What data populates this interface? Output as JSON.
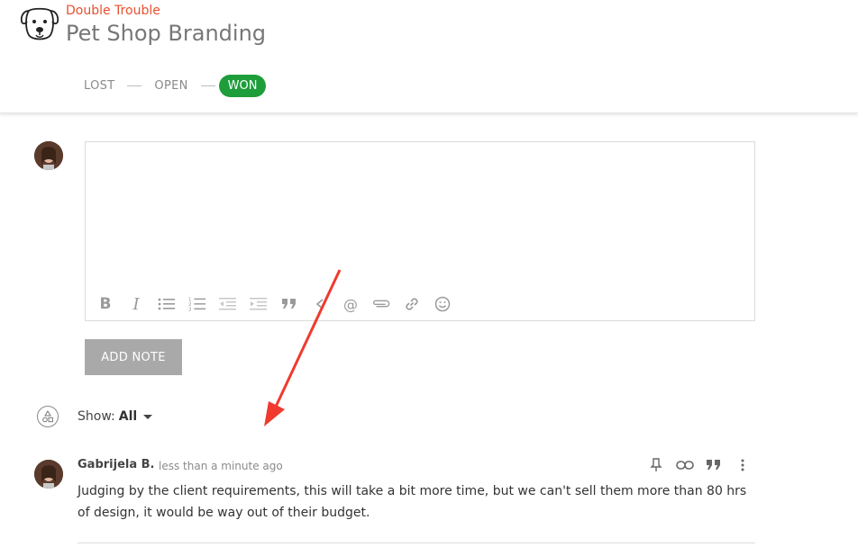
{
  "header": {
    "client_name": "Double Trouble",
    "project_title": "Pet Shop Branding",
    "logo_icon": "dog-face-icon",
    "stages": [
      {
        "label": "LOST",
        "active": false
      },
      {
        "label": "OPEN",
        "active": false
      },
      {
        "label": "WON",
        "active": true
      }
    ]
  },
  "editor": {
    "toolbar": [
      "bold-icon",
      "italic-icon",
      "bullet-list-icon",
      "numbered-list-icon",
      "outdent-icon",
      "indent-icon",
      "quote-icon",
      "code-icon",
      "mention-icon",
      "attachment-icon",
      "link-icon",
      "emoji-icon"
    ],
    "bold_glyph": "B",
    "italic_glyph": "I",
    "mention_glyph": "@",
    "add_note_label": "ADD NOTE"
  },
  "filter": {
    "show_label": "Show:",
    "show_value": "All"
  },
  "note": {
    "author": "Gabrijela B.",
    "time": "less than a minute ago",
    "body": "Judging by the client requirements, this will take a bit more time, but we can't sell them more than 80 hrs of design, it would be way out of their budget.",
    "actions": [
      "pin-icon",
      "link-icon",
      "quote-icon",
      "more-icon"
    ]
  },
  "colors": {
    "brand": "#e8502f",
    "won": "#1e9e3b",
    "annotation_arrow": "#f03a2e"
  }
}
